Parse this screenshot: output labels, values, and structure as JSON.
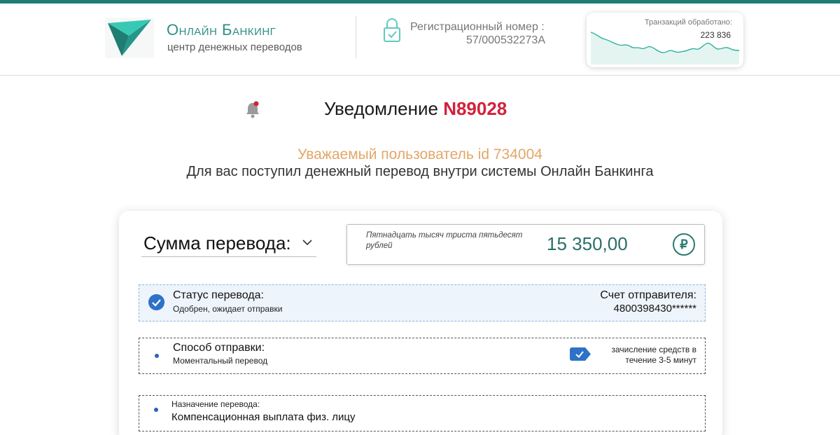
{
  "header": {
    "brand_title": "Онлайн Банкинг",
    "brand_subtitle": "центр денежных переводов",
    "reg_label": "Регистрационный номер :",
    "reg_number": "57/000532273А",
    "transactions_label": "Транзакций обработано:",
    "transactions_count": "223 836"
  },
  "notification": {
    "title": "Уведомление",
    "number": "N89028",
    "greeting": "Уважаемый пользователь id 734004",
    "message": "Для вас поступил денежный перевод внутри системы Онлайн Банкинга"
  },
  "transfer": {
    "amount_select_label": "Сумма перевода:",
    "amount_words": "Пятнадцать тысяч триста пятьдесят рублей",
    "amount_value": "15 350,00",
    "currency_symbol": "₽",
    "status_label": "Статус перевода:",
    "status_value": "Одобрен, ожидает отправки",
    "sender_label": "Счет отправителя:",
    "sender_value": "4800398430******",
    "method_label": "Способ отправки:",
    "method_value": "Моментальный перевод",
    "method_note": "зачисление средств в течение 3-5 минут",
    "purpose_label": "Назначение перевода:",
    "purpose_value": "Компенсационная выплата физ. лицу"
  },
  "colors": {
    "brand_teal": "#2d8f86",
    "notification_red": "#d3213b",
    "greeting_orange": "#e2a769",
    "status_blue": "#2d72c7"
  },
  "icons": [
    "logo-icon",
    "lock-icon",
    "bell-icon",
    "chevron-down-icon",
    "ruble-icon",
    "check-circle-icon",
    "check-badge-icon"
  ]
}
